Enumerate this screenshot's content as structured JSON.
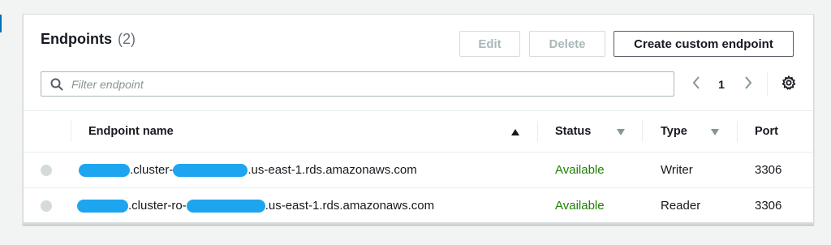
{
  "panel": {
    "title": "Endpoints",
    "count": "(2)",
    "buttons": {
      "edit": "Edit",
      "delete": "Delete",
      "create": "Create custom endpoint"
    },
    "filter": {
      "placeholder": "Filter endpoint",
      "value": ""
    },
    "pagination": {
      "current_page": "1"
    }
  },
  "table": {
    "columns": [
      {
        "label": "Endpoint name",
        "sort": "ascending"
      },
      {
        "label": "Status",
        "sort": "none"
      },
      {
        "label": "Type",
        "sort": "none"
      },
      {
        "label": "Port"
      }
    ],
    "rows": [
      {
        "endpoint_mid": ".cluster-",
        "endpoint_suffix": ".us-east-1.rds.amazonaws.com",
        "status": "Available",
        "type": "Writer",
        "port": "3306"
      },
      {
        "endpoint_mid": ".cluster-ro-",
        "endpoint_suffix": ".us-east-1.rds.amazonaws.com",
        "status": "Available",
        "type": "Reader",
        "port": "3306"
      }
    ]
  },
  "colors": {
    "status_available": "#1d8102",
    "redaction": "#1ea5ef",
    "primary_border": "#545b64",
    "disabled_text": "#aab7b8"
  },
  "icons": [
    "search-icon",
    "chevron-left-icon",
    "chevron-right-icon",
    "gear-icon",
    "sort-ascending-icon",
    "sort-descending-icon"
  ]
}
